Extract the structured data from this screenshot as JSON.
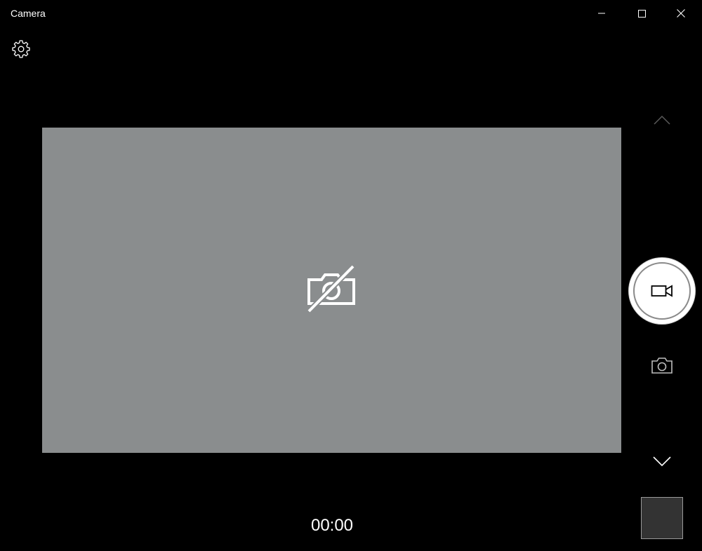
{
  "app": {
    "title": "Camera"
  },
  "window_controls": {
    "minimize_icon": "minimize-icon",
    "maximize_icon": "maximize-icon",
    "close_icon": "close-icon"
  },
  "toolbar": {
    "settings_icon": "gear-icon"
  },
  "viewfinder": {
    "background_color": "#8a8d8e",
    "status_icon": "camera-off-icon"
  },
  "controls": {
    "mode_up_icon": "chevron-up-icon",
    "capture_icon": "video-camera-icon",
    "photo_mode_icon": "camera-icon",
    "mode_down_icon": "chevron-down-icon"
  },
  "recording": {
    "timer": "00:00"
  },
  "colors": {
    "background": "#000000",
    "foreground": "#ffffff",
    "thumbnail": "#333333"
  }
}
